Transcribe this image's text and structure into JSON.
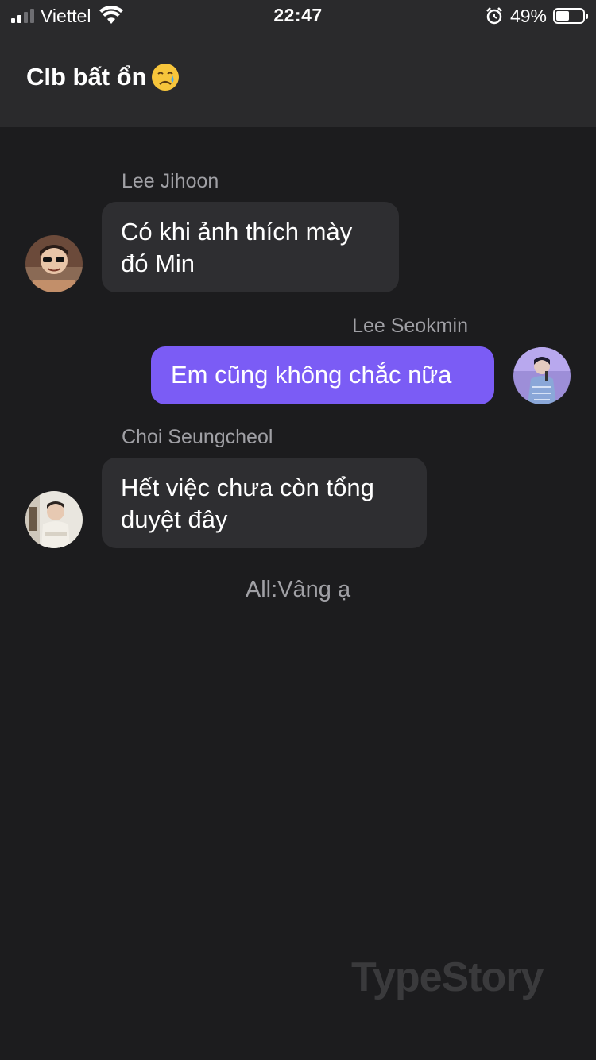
{
  "status_bar": {
    "carrier": "Viettel",
    "time": "22:47",
    "battery_percent": "49%",
    "battery_level": 0.49,
    "signal_bars_active": 2,
    "icons": [
      "signal-icon",
      "wifi-icon",
      "alarm-icon",
      "battery-icon"
    ]
  },
  "header": {
    "title": "Clb bất ổn",
    "title_emoji": "crying-face-emoji"
  },
  "messages": [
    {
      "sender": "Lee Jihoon",
      "text_lines": [
        "Có khi ảnh thích mày",
        "đó Min"
      ],
      "side": "left"
    },
    {
      "sender": "Lee Seokmin",
      "text_lines": [
        "Em cũng không chắc nữa"
      ],
      "side": "right"
    },
    {
      "sender": "Choi Seungcheol",
      "text_lines": [
        "Hết việc chưa còn tổng",
        "duyệt đây"
      ],
      "side": "left"
    }
  ],
  "system_message": "All:Vâng ạ",
  "watermark": "TypeStory",
  "colors": {
    "background": "#1c1c1e",
    "header_background": "#2a2a2c",
    "incoming_bubble": "#2e2e31",
    "outgoing_bubble": "#7b5cf5",
    "sender_name": "#a0a0a5"
  }
}
